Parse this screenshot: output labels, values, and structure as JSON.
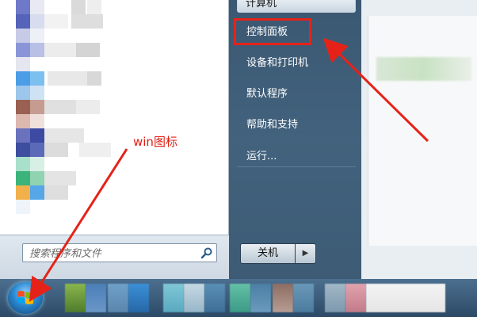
{
  "right_menu": {
    "computer": "计算机",
    "control_panel": "控制面板",
    "devices_printers": "设备和打印机",
    "default_programs": "默认程序",
    "help_support": "帮助和支持",
    "run": "运行..."
  },
  "search": {
    "placeholder": "搜索程序和文件"
  },
  "shutdown": {
    "label": "关机",
    "arrow": "▶"
  },
  "annotation": {
    "label": "win图标",
    "color": "#e01e12"
  },
  "colors": {
    "highlight_border": "#e62218",
    "right_pane": "#42627d"
  }
}
